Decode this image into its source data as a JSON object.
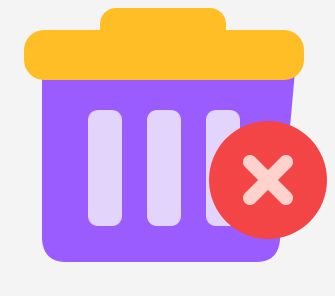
{
  "icon": {
    "name": "delete-trash-icon",
    "colors": {
      "background": "#f4f4f4",
      "lid": "#ffbe26",
      "bin_body": "#9a5cff",
      "bin_slots": "#e2d4fb",
      "badge": "#f34545",
      "badge_mark": "#ffd3cc"
    }
  }
}
